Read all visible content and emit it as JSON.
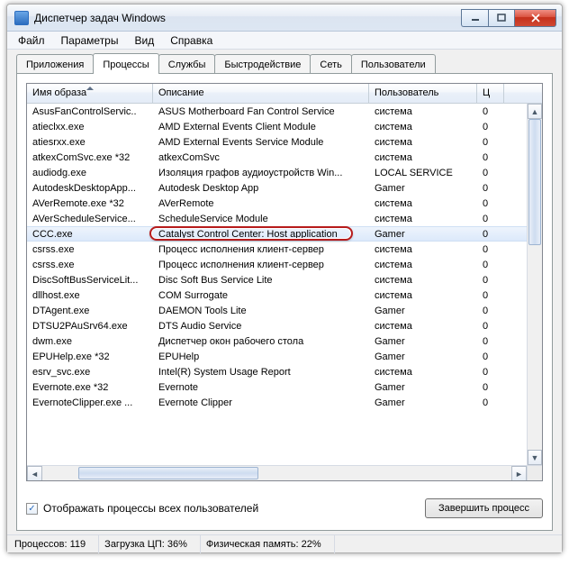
{
  "window": {
    "title": "Диспетчер задач Windows"
  },
  "menu": {
    "file": "Файл",
    "options": "Параметры",
    "view": "Вид",
    "help": "Справка"
  },
  "tabs": {
    "apps": "Приложения",
    "procs": "Процессы",
    "services": "Службы",
    "perf": "Быстродействие",
    "net": "Сеть",
    "users": "Пользователи"
  },
  "columns": {
    "image": "Имя образа",
    "desc": "Описание",
    "user": "Пользователь",
    "cpu": "Ц"
  },
  "rows": [
    {
      "img": "AsusFanControlServic..",
      "desc": "ASUS Motherboard Fan Control Service",
      "user": "система",
      "cpu": "0"
    },
    {
      "img": "atieclxx.exe",
      "desc": "AMD External Events Client Module",
      "user": "система",
      "cpu": "0"
    },
    {
      "img": "atiesrxx.exe",
      "desc": "AMD External Events Service Module",
      "user": "система",
      "cpu": "0"
    },
    {
      "img": "atkexComSvc.exe *32",
      "desc": "atkexComSvc",
      "user": "система",
      "cpu": "0"
    },
    {
      "img": "audiodg.exe",
      "desc": "Изоляция графов аудиоустройств Win...",
      "user": "LOCAL SERVICE",
      "cpu": "0"
    },
    {
      "img": "AutodeskDesktopApp...",
      "desc": "Autodesk Desktop App",
      "user": "Gamer",
      "cpu": "0"
    },
    {
      "img": "AVerRemote.exe *32",
      "desc": "AVerRemote",
      "user": "система",
      "cpu": "0"
    },
    {
      "img": "AVerScheduleService...",
      "desc": "ScheduleService Module",
      "user": "система",
      "cpu": "0"
    },
    {
      "img": "CCC.exe",
      "desc": "Catalyst Control Center: Host application",
      "user": "Gamer",
      "cpu": "0",
      "selected": true
    },
    {
      "img": "csrss.exe",
      "desc": "Процесс исполнения клиент-сервер",
      "user": "система",
      "cpu": "0"
    },
    {
      "img": "csrss.exe",
      "desc": "Процесс исполнения клиент-сервер",
      "user": "система",
      "cpu": "0"
    },
    {
      "img": "DiscSoftBusServiceLit...",
      "desc": "Disc Soft Bus Service Lite",
      "user": "система",
      "cpu": "0"
    },
    {
      "img": "dllhost.exe",
      "desc": "COM Surrogate",
      "user": "система",
      "cpu": "0"
    },
    {
      "img": "DTAgent.exe",
      "desc": "DAEMON Tools Lite",
      "user": "Gamer",
      "cpu": "0"
    },
    {
      "img": "DTSU2PAuSrv64.exe",
      "desc": "DTS Audio Service",
      "user": "система",
      "cpu": "0"
    },
    {
      "img": "dwm.exe",
      "desc": "Диспетчер окон рабочего стола",
      "user": "Gamer",
      "cpu": "0"
    },
    {
      "img": "EPUHelp.exe *32",
      "desc": "EPUHelp",
      "user": "Gamer",
      "cpu": "0"
    },
    {
      "img": "esrv_svc.exe",
      "desc": "Intel(R) System Usage Report",
      "user": "система",
      "cpu": "0"
    },
    {
      "img": "Evernote.exe *32",
      "desc": "Evernote",
      "user": "Gamer",
      "cpu": "0"
    },
    {
      "img": "EvernoteClipper.exe ...",
      "desc": "Evernote Clipper",
      "user": "Gamer",
      "cpu": "0"
    }
  ],
  "bottom": {
    "show_all": "Отображать процессы всех пользователей",
    "end_process": "Завершить процесс"
  },
  "status": {
    "procs": "Процессов: 119",
    "cpu": "Загрузка ЦП: 36%",
    "mem": "Физическая память: 22%"
  }
}
